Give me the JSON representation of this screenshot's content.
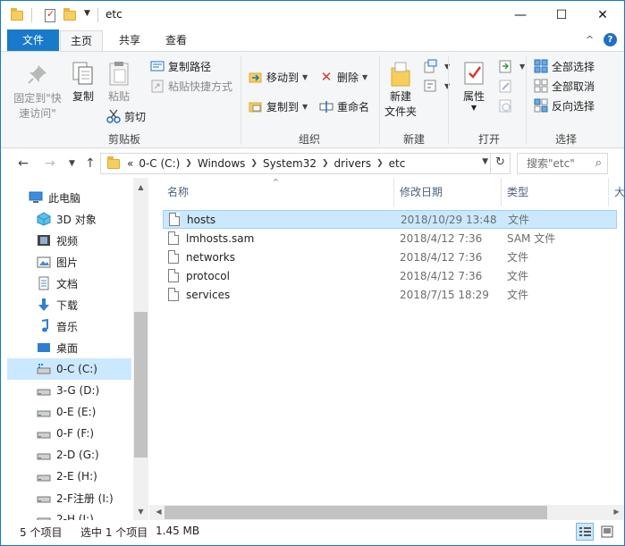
{
  "window": {
    "title": "etc",
    "minimize": "—",
    "maximize": "☐",
    "close": "✕"
  },
  "ribbon_tabs": [
    "文件",
    "主页",
    "共享",
    "查看"
  ],
  "ribbon_ctl": {
    "collapse": "^",
    "help": "?"
  },
  "ribbon": {
    "clipboard": {
      "label": "剪贴板",
      "pin": [
        "固定到\"快",
        "速访问\""
      ],
      "copy": "复制",
      "paste": "粘贴",
      "copy_path": "复制路径",
      "paste_shortcut": "粘贴快捷方式",
      "cut": "剪切"
    },
    "organize": {
      "label": "组织",
      "move_to": "移动到",
      "copy_to": "复制到",
      "delete": "删除",
      "rename": "重命名"
    },
    "new": {
      "label": "新建",
      "new_folder": [
        "新建",
        "文件夹"
      ]
    },
    "open": {
      "label": "打开",
      "properties": "属性"
    },
    "select": {
      "label": "选择",
      "select_all": "全部选择",
      "select_none": "全部取消",
      "invert": "反向选择"
    }
  },
  "address": {
    "crumbs": [
      "0-C (C:)",
      "Windows",
      "System32",
      "drivers",
      "etc"
    ],
    "search_placeholder": "搜索\"etc\""
  },
  "nav": [
    {
      "label": "此电脑",
      "icon": "computer-icon"
    },
    {
      "label": "3D 对象",
      "icon": "3d-objects-icon"
    },
    {
      "label": "视频",
      "icon": "video-icon"
    },
    {
      "label": "图片",
      "icon": "pictures-icon"
    },
    {
      "label": "文档",
      "icon": "documents-icon"
    },
    {
      "label": "下载",
      "icon": "download-icon"
    },
    {
      "label": "音乐",
      "icon": "music-icon"
    },
    {
      "label": "桌面",
      "icon": "desktop-icon"
    },
    {
      "label": "0-C (C:)",
      "icon": "drive-icon",
      "selected": true
    },
    {
      "label": "3-G (D:)",
      "icon": "drive-icon"
    },
    {
      "label": "0-E (E:)",
      "icon": "drive-icon"
    },
    {
      "label": "0-F (F:)",
      "icon": "drive-icon"
    },
    {
      "label": "2-D (G:)",
      "icon": "drive-icon"
    },
    {
      "label": "2-E (H:)",
      "icon": "drive-icon"
    },
    {
      "label": "2-F注册 (I:)",
      "icon": "drive-icon"
    },
    {
      "label": "2-H (J:)",
      "icon": "drive-icon"
    }
  ],
  "columns": {
    "name": "名称",
    "date": "修改日期",
    "type": "类型",
    "size": "大"
  },
  "files": [
    {
      "name": "hosts",
      "date": "2018/10/29 13:48",
      "type": "文件",
      "selected": true
    },
    {
      "name": "lmhosts.sam",
      "date": "2018/4/12 7:36",
      "type": "SAM 文件"
    },
    {
      "name": "networks",
      "date": "2018/4/12 7:36",
      "type": "文件"
    },
    {
      "name": "protocol",
      "date": "2018/4/12 7:36",
      "type": "文件"
    },
    {
      "name": "services",
      "date": "2018/7/15 18:29",
      "type": "文件"
    }
  ],
  "status": {
    "count": "5 个项目",
    "selection": "选中 1 个项目",
    "size": "1.45 MB"
  }
}
